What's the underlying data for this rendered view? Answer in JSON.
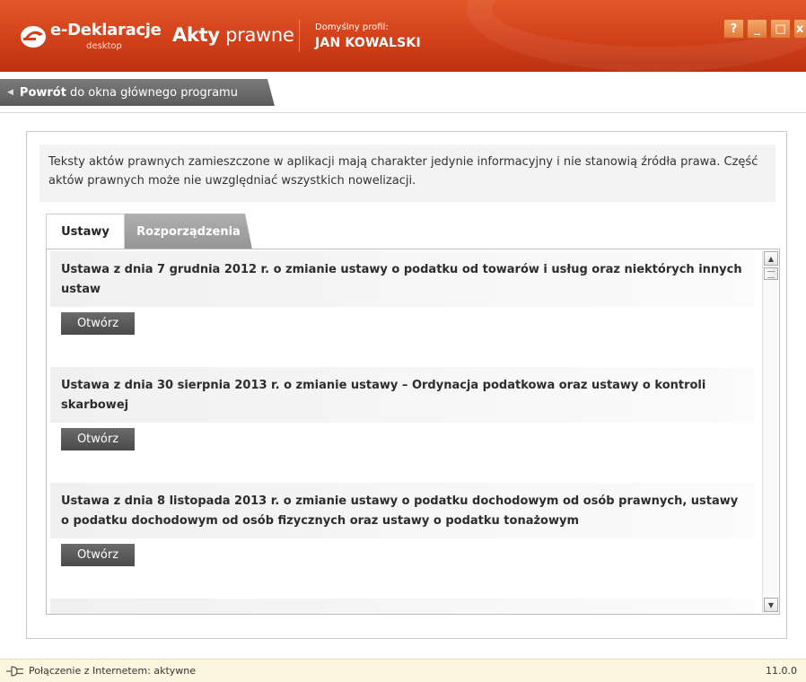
{
  "titlebar": {
    "logo_text": "e-Deklaracje",
    "logo_sub": "desktop",
    "app_title_bold": "Akty",
    "app_title_rest": " prawne",
    "profile_label": "Domyślny profil:",
    "profile_name": "JAN KOWALSKI",
    "window_buttons": {
      "help": "?",
      "minimize": "_",
      "maximize": "□",
      "close": "x"
    }
  },
  "nav": {
    "back_bold": "Powrót",
    "back_rest": "do okna głównego programu"
  },
  "notice": "Teksty aktów prawnych zamieszczone w aplikacji mają charakter jedynie informacyjny i nie stanowią źródła prawa. Część aktów prawnych może nie uwzględniać wszystkich nowelizacji.",
  "tabs": {
    "active": "Ustawy",
    "inactive": "Rozporządzenia"
  },
  "items": [
    {
      "title": "Ustawa z dnia 7 grudnia 2012 r. o zmianie ustawy o podatku od towarów i usług oraz niektórych innych ustaw",
      "button": "Otwórz"
    },
    {
      "title": "Ustawa z dnia 30 sierpnia 2013 r. o zmianie ustawy – Ordynacja podatkowa oraz ustawy o kontroli skarbowej",
      "button": "Otwórz"
    },
    {
      "title": "Ustawa z dnia 8 listopada 2013 r. o zmianie ustawy o podatku dochodowym od osób prawnych, ustawy o podatku dochodowym od osób fizycznych oraz ustawy o podatku tonażowym",
      "button": "Otwórz"
    }
  ],
  "status": {
    "connection": "Połączenie z Internetem: aktywne",
    "version": "11.0.0"
  },
  "colors": {
    "brand": "#d2401a",
    "button_dark": "#555555",
    "status_bg": "#fbf6dd"
  }
}
